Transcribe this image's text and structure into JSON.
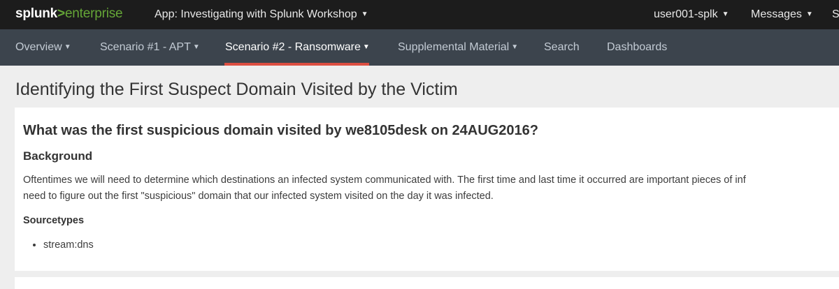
{
  "topbar": {
    "logo_part1": "splunk",
    "logo_arrow": ">",
    "logo_part2": "enterprise",
    "app_label": "App: Investigating with Splunk Workshop",
    "user_label": "user001-splk",
    "messages_label": "Messages",
    "cut_label": "S",
    "caret": "▼"
  },
  "nav": {
    "items": [
      {
        "label": "Overview",
        "dropdown": true
      },
      {
        "label": "Scenario #1 - APT",
        "dropdown": true
      },
      {
        "label": "Scenario #2 - Ransomware",
        "dropdown": true,
        "active": true
      },
      {
        "label": "Supplemental Material",
        "dropdown": true
      },
      {
        "label": "Search",
        "dropdown": false
      },
      {
        "label": "Dashboards",
        "dropdown": false
      }
    ],
    "caret": "▼"
  },
  "page": {
    "title": "Identifying the First Suspect Domain Visited by the Victim"
  },
  "panel": {
    "question": "What was the first suspicious domain visited by we8105desk on 24AUG2016?",
    "background_heading": "Background",
    "paragraph_line1": "Oftentimes we will need to determine which destinations an infected system communicated with. The first time and last time it occurred are important pieces of inf",
    "paragraph_line2": "need to figure out the first \"suspicious\" domain that our infected system visited on the day it was infected.",
    "sourcetypes_heading": "Sourcetypes",
    "sourcetypes": [
      "stream:dns"
    ]
  },
  "colors": {
    "topbar_bg": "#1c1c1c",
    "nav_bg": "#3c444d",
    "brand_green": "#65a637",
    "active_underline": "#dc4e41",
    "page_bg": "#eeeeee"
  }
}
